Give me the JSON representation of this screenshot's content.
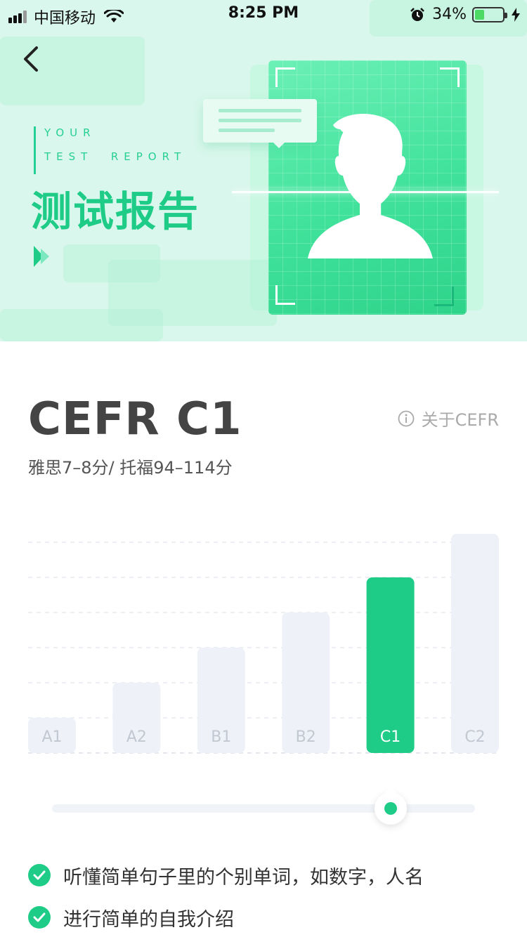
{
  "status_bar": {
    "carrier": "中国移动",
    "time": "8:25 PM",
    "battery_percent": "34%",
    "battery_level": 0.34,
    "icons": [
      "signal-icon",
      "wifi-icon",
      "alarm-icon",
      "battery-icon",
      "charging-bolt-icon"
    ]
  },
  "header": {
    "back_icon": "chevron-left-icon",
    "en_title_line1": "YOUR",
    "en_title_line2": "TEST  REPORT",
    "cn_title": "测试报告",
    "illustration": "person-avatar-scan-card"
  },
  "result": {
    "level": "CEFR C1",
    "about_label": "关于CEFR",
    "about_icon": "info-icon",
    "equivalents": "雅思7–8分/ 托福94–114分"
  },
  "chart_data": {
    "type": "bar",
    "categories": [
      "A1",
      "A2",
      "B1",
      "B2",
      "C1",
      "C2"
    ],
    "values": [
      1,
      2,
      3,
      4,
      5,
      6
    ],
    "highlight": "C1",
    "colors": {
      "highlight": "#1ecc88",
      "default": "#eef1f7",
      "label_default": "#c2c8d2",
      "label_highlight": "#ffffff"
    },
    "grid": true,
    "title": "",
    "xlabel": "",
    "ylabel": ""
  },
  "level_slider": {
    "value": 0.8,
    "accent": "#1ecc88"
  },
  "skills": [
    {
      "text": "听懂简单句子里的个别单词，如数字，人名",
      "icon": "check-circle-icon"
    },
    {
      "text": "进行简单的自我介绍",
      "icon": "check-circle-icon"
    }
  ],
  "colors": {
    "accent": "#1ecc88",
    "hero_bg": "#d9f7ec"
  }
}
